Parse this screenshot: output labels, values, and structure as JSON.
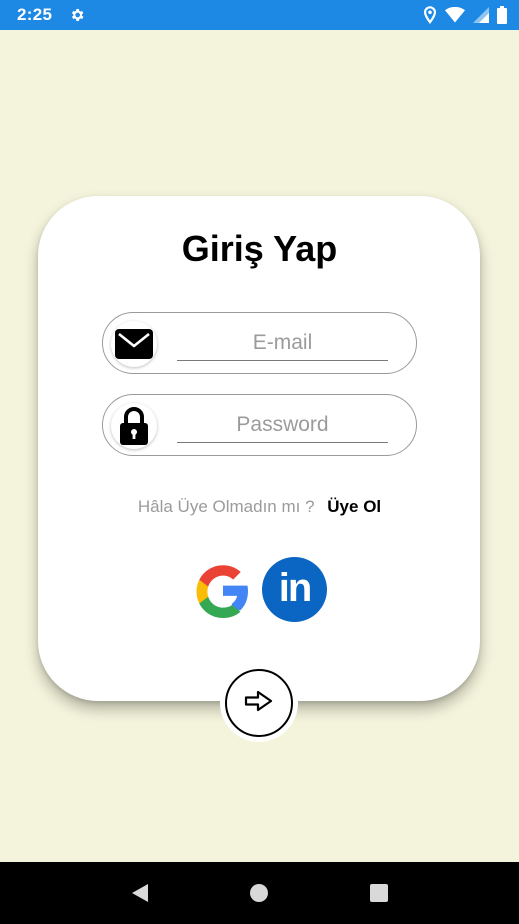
{
  "status_bar": {
    "time": "2:25",
    "settings_icon": "gear-icon",
    "icons": [
      "location-icon",
      "wifi-icon",
      "signal-icon",
      "battery-icon"
    ],
    "background_color": "#1e88e5"
  },
  "login": {
    "title": "Giriş Yap",
    "email": {
      "placeholder": "E-mail",
      "value": "",
      "icon": "mail-icon"
    },
    "password": {
      "placeholder": "Password",
      "value": "",
      "icon": "lock-icon"
    },
    "signup_question": "Hâla Üye Olmadın mı ?",
    "signup_link": "Üye Ol",
    "social": [
      {
        "name": "google",
        "icon": "google-icon"
      },
      {
        "name": "linkedin",
        "icon": "linkedin-icon",
        "label": "in",
        "color": "#0a66c2"
      }
    ],
    "submit_icon": "arrow-right-icon",
    "background_color": "#f4f4dc"
  },
  "nav_bar": {
    "buttons": [
      "back-icon",
      "home-icon",
      "recents-icon"
    ]
  }
}
